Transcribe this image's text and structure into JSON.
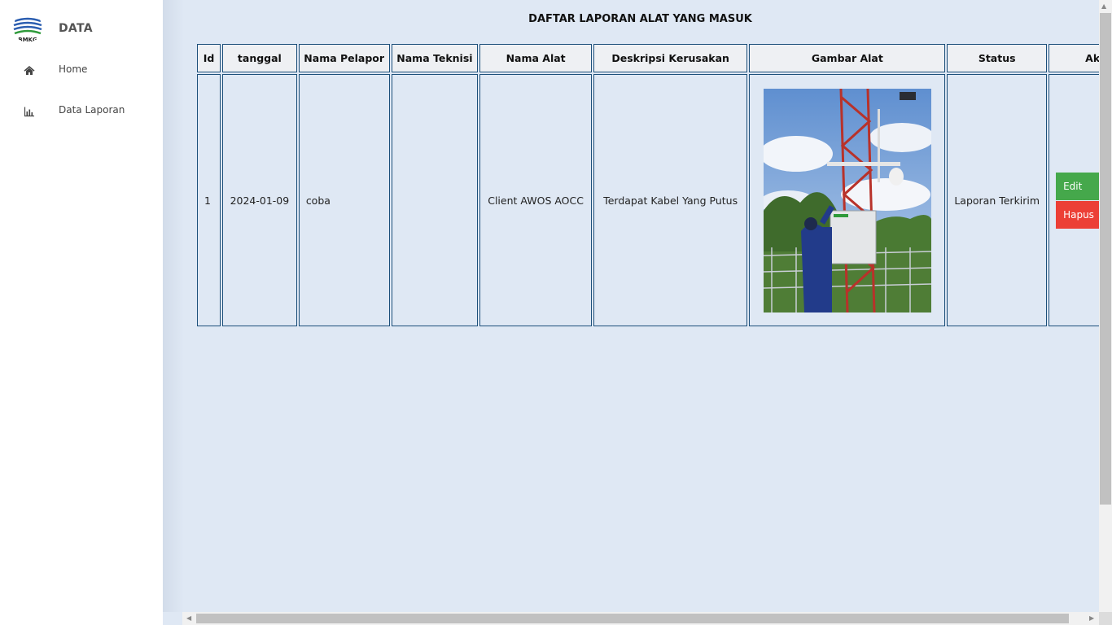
{
  "sidebar": {
    "brand": "DATA",
    "logo_icon": "bmkg-logo",
    "items": [
      {
        "label": "Home",
        "icon": "home-icon"
      },
      {
        "label": "Data Laporan",
        "icon": "bar-chart-icon"
      }
    ]
  },
  "main": {
    "title": "DAFTAR LAPORAN ALAT YANG MASUK",
    "columns": [
      "Id",
      "tanggal",
      "Nama Pelapor",
      "Nama Teknisi",
      "Nama Alat",
      "Deskripsi Kerusakan",
      "Gambar Alat",
      "Status",
      "Aksi"
    ],
    "rows": [
      {
        "id": "1",
        "tanggal": "2024-01-09",
        "nama_pelapor": "coba",
        "nama_teknisi": "",
        "nama_alat": "Client AWOS AOCC",
        "deskripsi": "Terdapat Kabel Yang Putus",
        "gambar": "equipment-photo",
        "status": "Laporan Terkirim",
        "actions": {
          "edit": "Edit",
          "delete": "Hapus"
        }
      }
    ]
  },
  "colors": {
    "edit": "#45a84b",
    "delete": "#ec3f36",
    "content_bg": "#dfe8f4",
    "table_border": "#1c4f7a"
  }
}
